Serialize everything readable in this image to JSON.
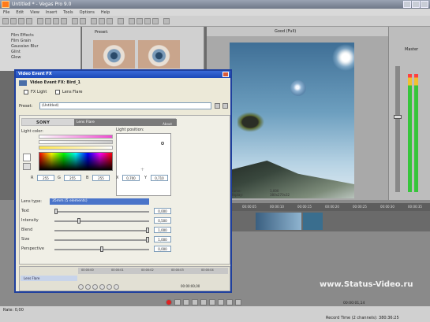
{
  "app": {
    "title": "Untitled * - Vegas Pro 9.0",
    "menu": [
      "File",
      "Edit",
      "View",
      "Insert",
      "Tools",
      "Options",
      "Help"
    ]
  },
  "left_pane": {
    "items": [
      "Film Effects",
      "Film Grain",
      "Gaussian Blur",
      "Glint",
      "Glow"
    ]
  },
  "preset_pane": {
    "title": "Preset:"
  },
  "preview": {
    "quality": "Good (Full)",
    "frame_label": "Frame:",
    "display_label": "Display:",
    "frame_value": "1,000",
    "display_value": "380x270x32",
    "project_info": "320x240x32, 29,970",
    "preview_info": "320x240x32, 29,970"
  },
  "mixer": {
    "label": "Master"
  },
  "timeline": {
    "ruler_labels": [
      "00:00:00",
      "00:00:05",
      "00:00:10",
      "00:00:15",
      "00:00:20",
      "00:00:25",
      "00:00:30",
      "00:00:35"
    ],
    "watermark": "www.Status-Video.ru"
  },
  "status": {
    "rate": "Rate: 0,00",
    "record_info": "Record Time (2 channels): 380:36:25",
    "position": "00:00:01,14"
  },
  "dialog": {
    "title": "Video Event FX",
    "subtitle": "Video Event FX: Bird_1",
    "chain": [
      "FX Light",
      "Lens Flare"
    ],
    "preset_label": "Preset:",
    "preset_value": "(Untitled)",
    "brand": "SONY",
    "plugin_name": "Lens Flare",
    "about": "About",
    "light_color_label": "Light color:",
    "light_position_label": "Light position:",
    "rgb": {
      "r": "255",
      "g": "255",
      "b": "255"
    },
    "xy": {
      "x": "0,700",
      "y": "0,710"
    },
    "lens_type_label": "Lens type:",
    "lens_type_value": "35mm (5 elements)",
    "sliders": [
      {
        "label": "Text",
        "value": "0,000",
        "level": 0.0
      },
      {
        "label": "Intensity",
        "value": "0,500",
        "level": 0.25
      },
      {
        "label": "Blend",
        "value": "1,000",
        "level": 1.0
      },
      {
        "label": "Size",
        "value": "1,000",
        "level": 1.0
      },
      {
        "label": "Perspective",
        "value": "0,000",
        "level": 0.5
      }
    ],
    "keyframe_row": "Lens Flare",
    "keyframe_time": "00:00:00,00",
    "kf_ticks": [
      "00:00:00",
      "00:00:01",
      "00:00:02",
      "00:00:03",
      "00:00:04"
    ]
  },
  "colors": {
    "dialog_title": "#1c49b8",
    "lens_select": "#4a74c9",
    "app_icon": "#ff7a1a"
  }
}
